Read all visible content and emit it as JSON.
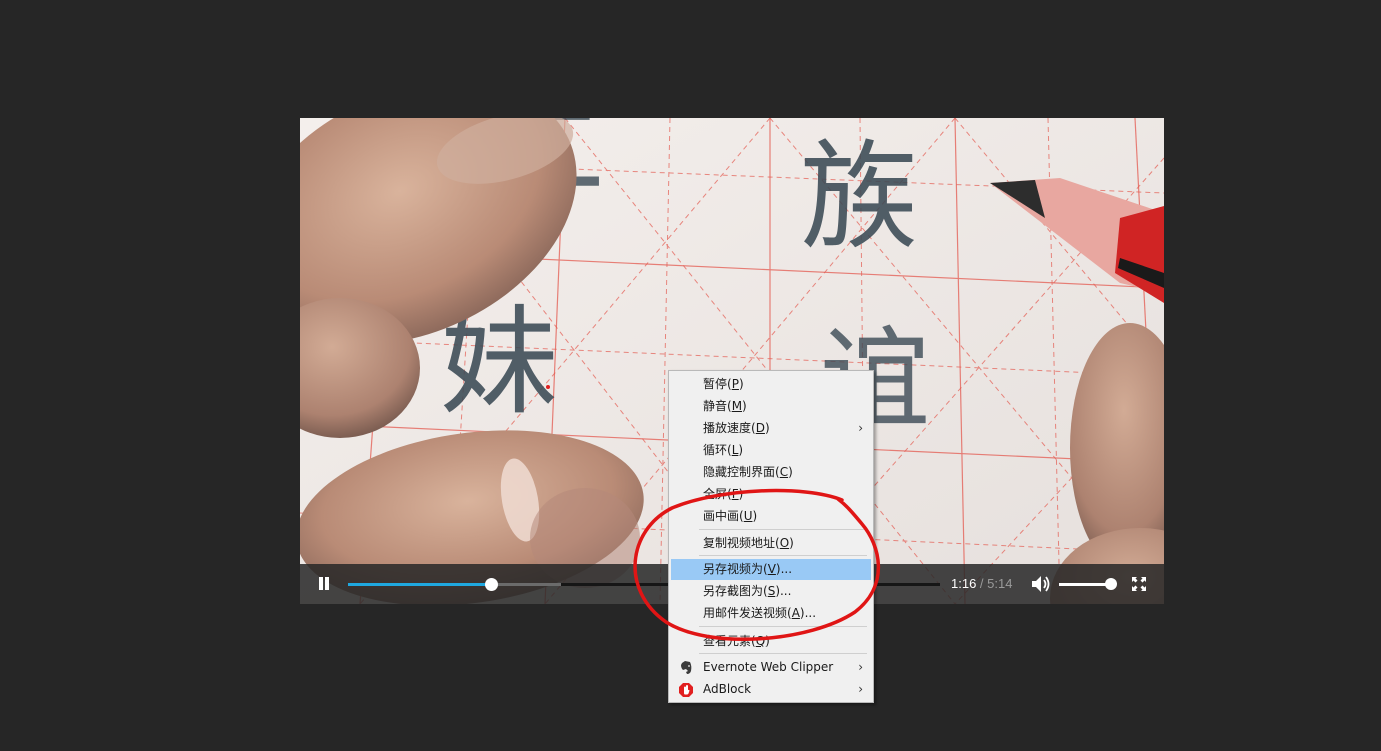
{
  "player": {
    "time_current": "1:16",
    "time_separator": " / ",
    "time_duration": "5:14",
    "progress_played_fraction": 0.242,
    "progress_buffered_fraction": 0.36,
    "volume_fraction": 0.9,
    "icons": {
      "pause": "pause-icon",
      "volume": "volume-icon",
      "fullscreen": "fullscreen-icon"
    },
    "colors": {
      "progress": "#1fa8e0",
      "controls_bg": "#282828"
    }
  },
  "video": {
    "visible_characters": [
      "妹",
      "族"
    ]
  },
  "context_menu": {
    "items": [
      {
        "label": "暂停(",
        "key": "P",
        "suffix": ")"
      },
      {
        "label": "静音(",
        "key": "M",
        "suffix": ")"
      },
      {
        "label": "播放速度(",
        "key": "D",
        "suffix": ")",
        "submenu": true
      },
      {
        "label": "循环(",
        "key": "L",
        "suffix": ")"
      },
      {
        "label": "隐藏控制界面(",
        "key": "C",
        "suffix": ")"
      },
      {
        "label": "全屏(",
        "key": "F",
        "suffix": ")"
      },
      {
        "label": "画中画(",
        "key": "U",
        "suffix": ")"
      },
      {
        "label": "复制视频地址(",
        "key": "O",
        "suffix": ")"
      },
      {
        "label": "另存视频为(",
        "key": "V",
        "suffix": ")...",
        "highlighted": true
      },
      {
        "label": "另存截图为(",
        "key": "S",
        "suffix": ")..."
      },
      {
        "label": "用邮件发送视频(",
        "key": "A",
        "suffix": ")..."
      },
      {
        "label": "查看元素(",
        "key": "Q",
        "suffix": ")"
      },
      {
        "label": "Evernote Web Clipper",
        "key": "",
        "suffix": "",
        "submenu": true,
        "icon": "evernote-icon"
      },
      {
        "label": "AdBlock",
        "key": "",
        "suffix": "",
        "submenu": true,
        "icon": "adblock-icon"
      }
    ],
    "submenu_arrow": "›",
    "highlight_color": "#99c9f5"
  },
  "annotation": {
    "color": "#e01515",
    "shape": "hand-drawn ellipse around save-video menu items"
  }
}
